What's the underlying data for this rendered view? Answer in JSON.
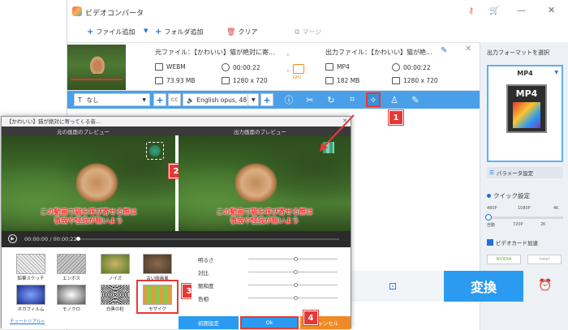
{
  "app": {
    "title": "ビデオコンバータ"
  },
  "toolbar": {
    "add_file": "ファイル追加",
    "add_folder": "フォルダ追加",
    "clear": "クリア",
    "merge": "マージ"
  },
  "file": {
    "source_label": "元ファイル：【かわいい】猫が絶対に寄...",
    "output_label": "出力ファイル：【かわいい】猫が絶...",
    "src_format": "WEBM",
    "src_duration": "00:00:22",
    "src_size": "73.93 MB",
    "src_resolution": "1280 x 720",
    "out_format": "MP4",
    "out_duration": "00:00:22",
    "out_size": "182 MB",
    "out_resolution": "1280 x 720",
    "gpu_label": "GPU"
  },
  "editbar": {
    "subtitle_select": "なし",
    "audio_select": "English opus, 48"
  },
  "right_panel": {
    "output_format_heading": "出力フォーマットを選択",
    "format_name": "MP4",
    "format_icon_text": "MP4",
    "param_settings": "パラメータ設定",
    "quick_settings": "クイック設定",
    "quick_ticks_top": [
      "480P",
      "1080P",
      "4K"
    ],
    "quick_ticks_bottom": [
      "自動",
      "720P",
      "2K"
    ],
    "gpu_accel": "ビデオカード加速",
    "nvidia": "NVIDIA",
    "intel": "Intel"
  },
  "convert_label": "変換",
  "dialog": {
    "title": "【かわいい】猫が絶対に寄ってくる音...",
    "original_preview": "元の画面のプレビュー",
    "output_preview": "出力画面のプレビュー",
    "subtitle_line1": "この動画で猫を呼び寄せる際は",
    "subtitle_line2": "事故や怪我が無いよう",
    "timecode": "00:00:00 / 00:00:22",
    "filters": [
      {
        "label": "鉛筆スケッチ"
      },
      {
        "label": "エンボス"
      },
      {
        "label": "ノイズ"
      },
      {
        "label": "古い映画風"
      },
      {
        "label": "ネガフィルム"
      },
      {
        "label": "モノクロ"
      },
      {
        "label": "白黒の粒"
      },
      {
        "label": "モザイク"
      }
    ],
    "adjust": [
      {
        "label": "明るさ",
        "value": 0.5
      },
      {
        "label": "対比",
        "value": 0.5
      },
      {
        "label": "飽和度",
        "value": 0.5
      },
      {
        "label": "色相",
        "value": 0.5
      }
    ],
    "tutorial_link": "チュートリアル>",
    "reset": "初期設定",
    "ok": "Ok",
    "cancel": "キャンセル"
  },
  "badges": [
    "1",
    "2",
    "3",
    "4"
  ],
  "colors": {
    "accent": "#2a9bf0",
    "annotation": "#e53935",
    "cancel": "#f08a24"
  }
}
